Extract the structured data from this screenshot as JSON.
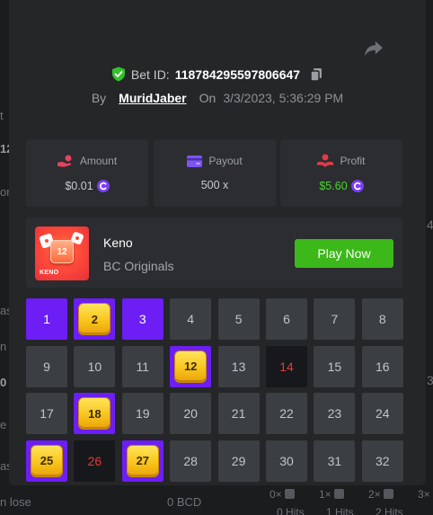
{
  "colors": {
    "background": "#1a1c1e",
    "modal": "#242628",
    "panel": "#2b2d30",
    "cell": "#3b3e42",
    "pick": "#6c1ef5",
    "hit_gold": "#f5c21b",
    "drawn_bg": "#17181b",
    "drawn_text": "#e53935",
    "accent_green": "#3cb81a",
    "profit_green": "#4ad72c"
  },
  "icons": {
    "share": "share-icon",
    "shield": "shield-check-icon",
    "copy": "copy-icon",
    "amount": "hand-coin-icon",
    "payout": "card-icon",
    "profit": "hand-person-icon",
    "coin": "bc-coin-icon"
  },
  "background": {
    "left_fragments": [
      "t",
      "12",
      "or",
      "as",
      "n",
      "0",
      "e",
      "as"
    ],
    "right_fragments": [
      "4",
      "3"
    ],
    "bottom": {
      "lose_text": "n lose",
      "balance_text": "0 BCD",
      "hit_counters": [
        {
          "label": "0×",
          "hits": "0 Hits"
        },
        {
          "label": "1×",
          "hits": "1 Hits"
        },
        {
          "label": "2×",
          "hits": "2 Hits"
        },
        {
          "label": "3×",
          "hits": ""
        }
      ]
    }
  },
  "bet": {
    "id_label": "Bet ID:",
    "id": "118784295597806647",
    "by_label": "By",
    "user": "MuridJaber",
    "on_label": "On",
    "timestamp": "3/3/2023, 5:36:29 PM"
  },
  "stats": {
    "amount": {
      "label": "Amount",
      "value": "$0.01"
    },
    "payout": {
      "label": "Payout",
      "value": "500 x"
    },
    "profit": {
      "label": "Profit",
      "value": "$5.60"
    }
  },
  "game": {
    "name": "Keno",
    "provider": "BC Originals",
    "play_label": "Play Now",
    "thumbnail": {
      "tile_number": "12",
      "label": "KENO"
    }
  },
  "grid": {
    "columns": 8,
    "cells": [
      {
        "n": 1,
        "state": "pick"
      },
      {
        "n": 2,
        "state": "hit"
      },
      {
        "n": 3,
        "state": "pick"
      },
      {
        "n": 4,
        "state": "none"
      },
      {
        "n": 5,
        "state": "none"
      },
      {
        "n": 6,
        "state": "none"
      },
      {
        "n": 7,
        "state": "none"
      },
      {
        "n": 8,
        "state": "none"
      },
      {
        "n": 9,
        "state": "none"
      },
      {
        "n": 10,
        "state": "none"
      },
      {
        "n": 11,
        "state": "none"
      },
      {
        "n": 12,
        "state": "hit"
      },
      {
        "n": 13,
        "state": "none"
      },
      {
        "n": 14,
        "state": "drawn"
      },
      {
        "n": 15,
        "state": "none"
      },
      {
        "n": 16,
        "state": "none"
      },
      {
        "n": 17,
        "state": "none"
      },
      {
        "n": 18,
        "state": "hit"
      },
      {
        "n": 19,
        "state": "none"
      },
      {
        "n": 20,
        "state": "none"
      },
      {
        "n": 21,
        "state": "none"
      },
      {
        "n": 22,
        "state": "none"
      },
      {
        "n": 23,
        "state": "none"
      },
      {
        "n": 24,
        "state": "none"
      },
      {
        "n": 25,
        "state": "hit"
      },
      {
        "n": 26,
        "state": "drawn"
      },
      {
        "n": 27,
        "state": "hit"
      },
      {
        "n": 28,
        "state": "none"
      },
      {
        "n": 29,
        "state": "none"
      },
      {
        "n": 30,
        "state": "none"
      },
      {
        "n": 31,
        "state": "none"
      },
      {
        "n": 32,
        "state": "none"
      }
    ]
  }
}
